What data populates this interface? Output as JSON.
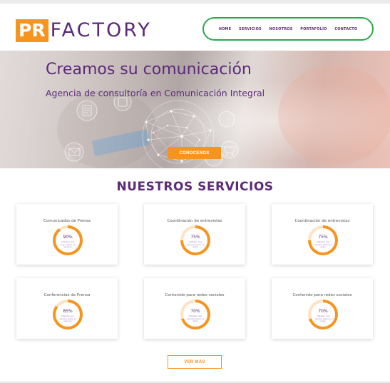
{
  "brand": {
    "logo_pr": "PR",
    "logo_factory": "FACTORY"
  },
  "nav": {
    "items": [
      {
        "label": "HOME"
      },
      {
        "label": "SERVICIOS"
      },
      {
        "label": "NOSOTROS"
      },
      {
        "label": "PORTAFOLIO"
      },
      {
        "label": "CONTACTO"
      }
    ]
  },
  "hero": {
    "title": "Creamos su comunicación",
    "subtitle": "Agencia de consultoría en Comunicación Integral",
    "button_label": "CONOCENOS"
  },
  "services": {
    "title": "NUESTROS SERVICIOS",
    "cards": [
      {
        "title": "Comunicados de Prensa",
        "percent": 90,
        "percent_label": "90%",
        "caption": "Clientes que han usado el servicio"
      },
      {
        "title": "Coordinación de entrevistas",
        "percent": 75,
        "percent_label": "75%",
        "caption": "Clientes que opinan sobre el éxito"
      },
      {
        "title": "Coordinación de entrevistas",
        "percent": 75,
        "percent_label": "75%",
        "caption": "Clientes que opinan sobre el éxito"
      },
      {
        "title": "Conferencias de Prensa",
        "percent": 85,
        "percent_label": "85%",
        "caption": "Clientes que opinan sobre el servicio"
      },
      {
        "title": "Contenido para redes sociales",
        "percent": 70,
        "percent_label": "70%",
        "caption": "Clientes que opinan sobre el éxito"
      },
      {
        "title": "Contenido para redes sociales",
        "percent": 70,
        "percent_label": "70%",
        "caption": "Clientes que opinan sobre el éxito"
      }
    ],
    "more_label": "VER MÁS"
  },
  "colors": {
    "brand_orange": "#f7941d",
    "brand_purple": "#5b2a78",
    "nav_border": "#2ca84a",
    "ring_track": "#fde3c4"
  }
}
